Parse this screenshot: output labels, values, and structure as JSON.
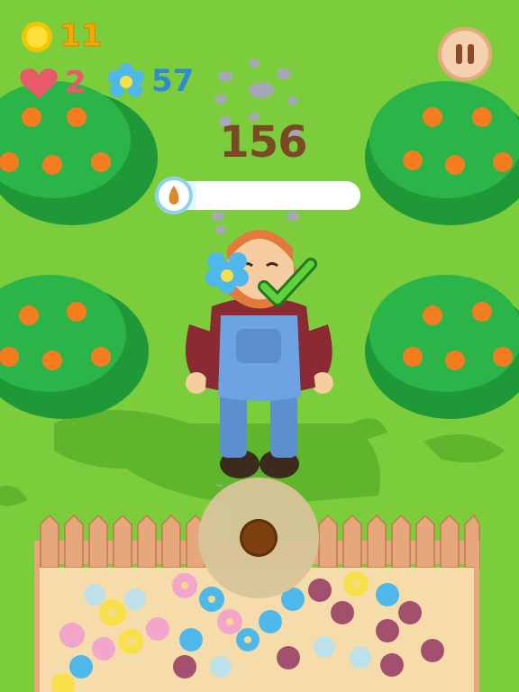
{
  "hud": {
    "coins": "11",
    "lives": "2",
    "flowers": "57",
    "score": "156",
    "water_progress": 0.18
  },
  "icons": {
    "coin": "coin-icon",
    "heart": "heart-icon",
    "flower": "blue-flower-icon",
    "pause": "pause-icon",
    "seed": "seed-icon",
    "check": "checkmark-icon"
  },
  "colors": {
    "grass": "#7ccd3c",
    "coin": "#f5a800",
    "heart": "#e85a6a",
    "flower_count": "#2f8ad6",
    "score": "#7a4a25"
  }
}
